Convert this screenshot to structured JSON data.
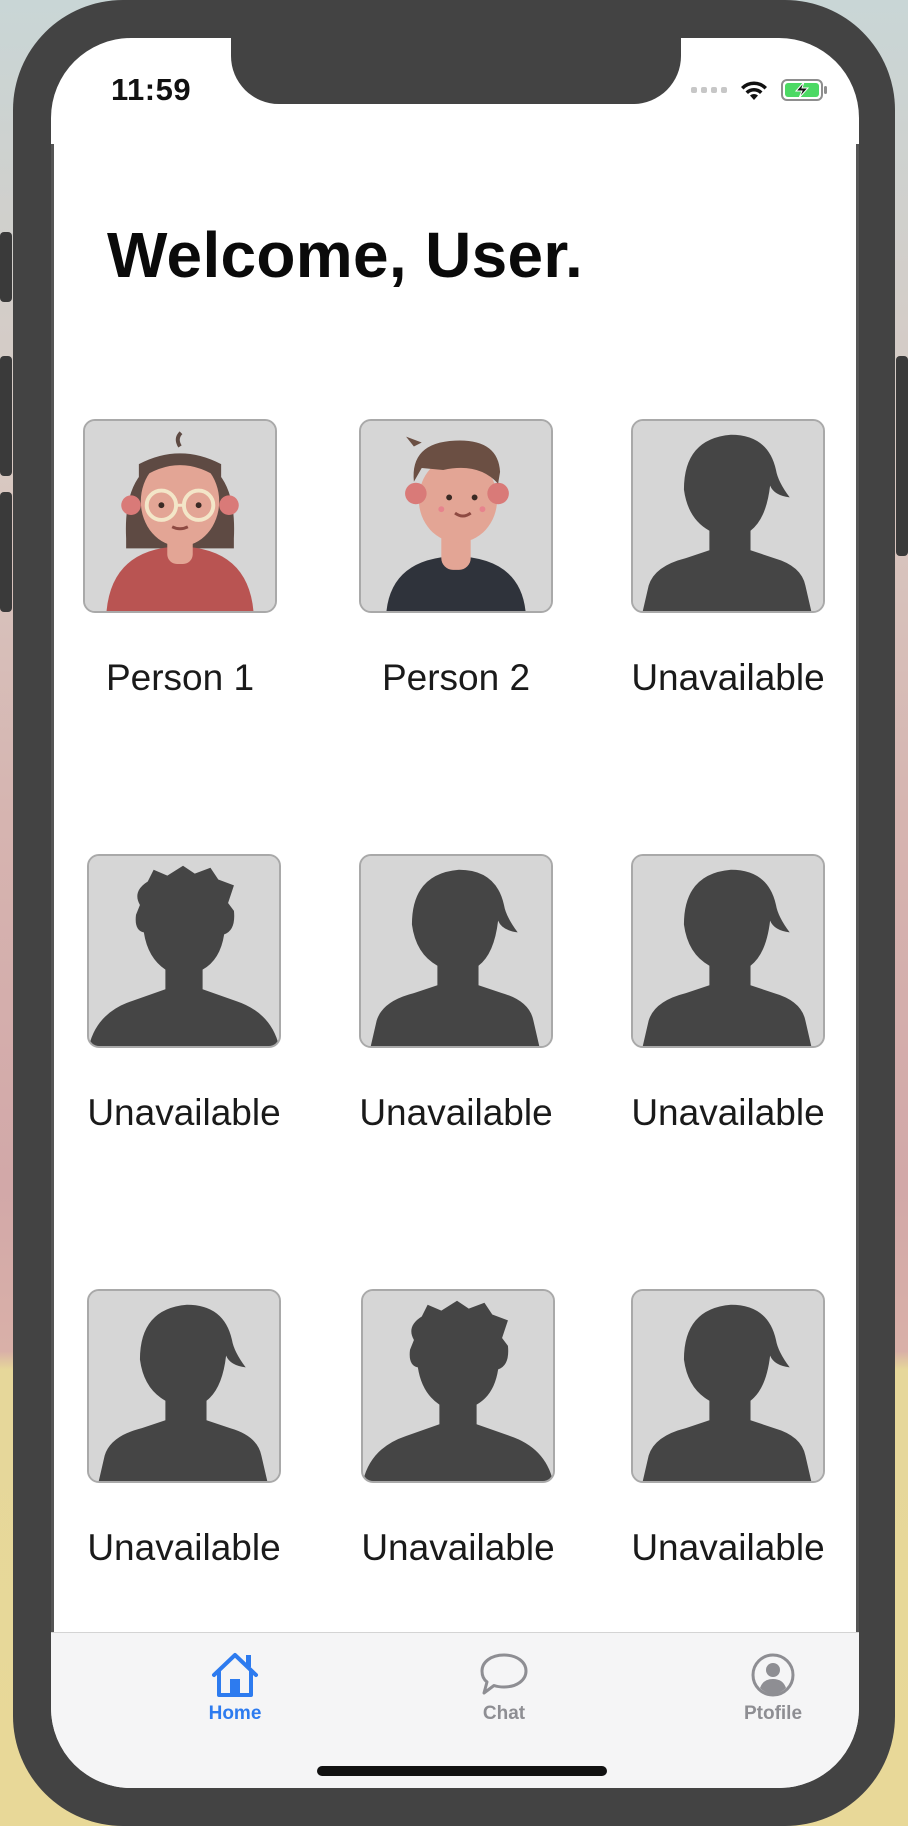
{
  "status_bar": {
    "time": "11:59"
  },
  "header": {
    "title": "Welcome, User."
  },
  "people": [
    {
      "label": "Person 1",
      "avatar": "female-illustration"
    },
    {
      "label": "Person 2",
      "avatar": "male-illustration"
    },
    {
      "label": "Unavailable",
      "avatar": "female-silhouette"
    },
    {
      "label": "Unavailable",
      "avatar": "male-silhouette"
    },
    {
      "label": "Unavailable",
      "avatar": "female-silhouette"
    },
    {
      "label": "Unavailable",
      "avatar": "female-silhouette"
    },
    {
      "label": "Unavailable",
      "avatar": "female-silhouette"
    },
    {
      "label": "Unavailable",
      "avatar": "male-silhouette"
    },
    {
      "label": "Unavailable",
      "avatar": "female-silhouette"
    }
  ],
  "tabbar": {
    "tabs": [
      {
        "label": "Home",
        "icon": "house-icon",
        "active": true
      },
      {
        "label": "Chat",
        "icon": "chat-bubble-icon",
        "active": false
      },
      {
        "label": "Ptofile",
        "icon": "person-circle-icon",
        "active": false
      }
    ]
  },
  "colors": {
    "accent": "#2d7bef",
    "inactive": "#8e8e93",
    "silhouette": "#454545",
    "avatar_bg": "#d6d6d6"
  }
}
